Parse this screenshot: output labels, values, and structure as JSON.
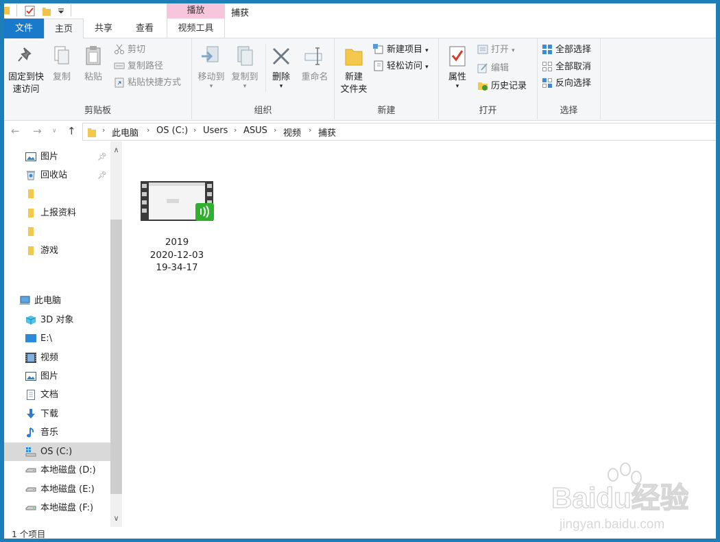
{
  "title_bar": {
    "context_tab_label": "播放",
    "window_title": "捕获"
  },
  "tabs": [
    {
      "label": "文件"
    },
    {
      "label": "主页"
    },
    {
      "label": "共享"
    },
    {
      "label": "查看"
    },
    {
      "label": "视频工具"
    }
  ],
  "ribbon": {
    "clipboard": {
      "group_label": "剪贴板",
      "pin_quick_access_line1": "固定到快",
      "pin_quick_access_line2": "速访问",
      "copy": "复制",
      "paste": "粘贴",
      "cut": "剪切",
      "copy_path": "复制路径",
      "paste_shortcut": "粘贴快捷方式"
    },
    "organize": {
      "group_label": "组织",
      "move_to": "移动到",
      "copy_to": "复制到",
      "delete": "删除",
      "rename": "重命名"
    },
    "new": {
      "group_label": "新建",
      "new_folder_line1": "新建",
      "new_folder_line2": "文件夹",
      "new_item": "新建项目",
      "easy_access": "轻松访问"
    },
    "open": {
      "group_label": "打开",
      "properties": "属性",
      "open": "打开",
      "edit": "编辑",
      "history": "历史记录"
    },
    "select": {
      "group_label": "选择",
      "select_all": "全部选择",
      "select_none": "全部取消",
      "invert_selection": "反向选择"
    }
  },
  "address": {
    "breadcrumbs": [
      "此电脑",
      "OS (C:)",
      "Users",
      "ASUS",
      "视频",
      "捕获"
    ]
  },
  "nav": {
    "quick_access": [
      {
        "label": "图片",
        "icon": "pictures-icon",
        "pinned": true
      },
      {
        "label": "回收站",
        "icon": "recycle-bin-icon",
        "pinned": true
      },
      {
        "label": "",
        "icon": "folder-icon"
      },
      {
        "label": "上报资料",
        "icon": "folder-icon"
      },
      {
        "label": "",
        "icon": "folder-icon"
      },
      {
        "label": "游戏",
        "icon": "folder-icon"
      }
    ],
    "this_pc_label": "此电脑",
    "this_pc_items": [
      {
        "label": "3D 对象",
        "icon": "3d-objects-icon"
      },
      {
        "label": "E:\\",
        "icon": "monitor-icon"
      },
      {
        "label": "视频",
        "icon": "videos-icon"
      },
      {
        "label": "图片",
        "icon": "pictures-icon"
      },
      {
        "label": "文档",
        "icon": "documents-icon"
      },
      {
        "label": "下载",
        "icon": "downloads-icon"
      },
      {
        "label": "音乐",
        "icon": "music-icon"
      },
      {
        "label": "OS (C:)",
        "icon": "os-drive-icon",
        "selected": true
      },
      {
        "label": "本地磁盘 (D:)",
        "icon": "drive-icon"
      },
      {
        "label": "本地磁盘 (E:)",
        "icon": "drive-icon"
      },
      {
        "label": "本地磁盘 (F:)",
        "icon": "drive-icon"
      }
    ]
  },
  "content": {
    "files": [
      {
        "name_line1": "2019",
        "name_line2": "2020-12-03",
        "name_line3": "19-34-17",
        "icon": "video-file-icon"
      }
    ]
  },
  "status": {
    "item_count": "1 个项目"
  },
  "watermark": {
    "brand": "Baidu经验",
    "url": "jingyan.baidu.com"
  },
  "colors": {
    "frame": "#1e7fb8",
    "file_tab": "#1979ca",
    "context_tab": "#f7c6dc",
    "selection": "#d9d9d9",
    "badge": "#2fb12f"
  }
}
